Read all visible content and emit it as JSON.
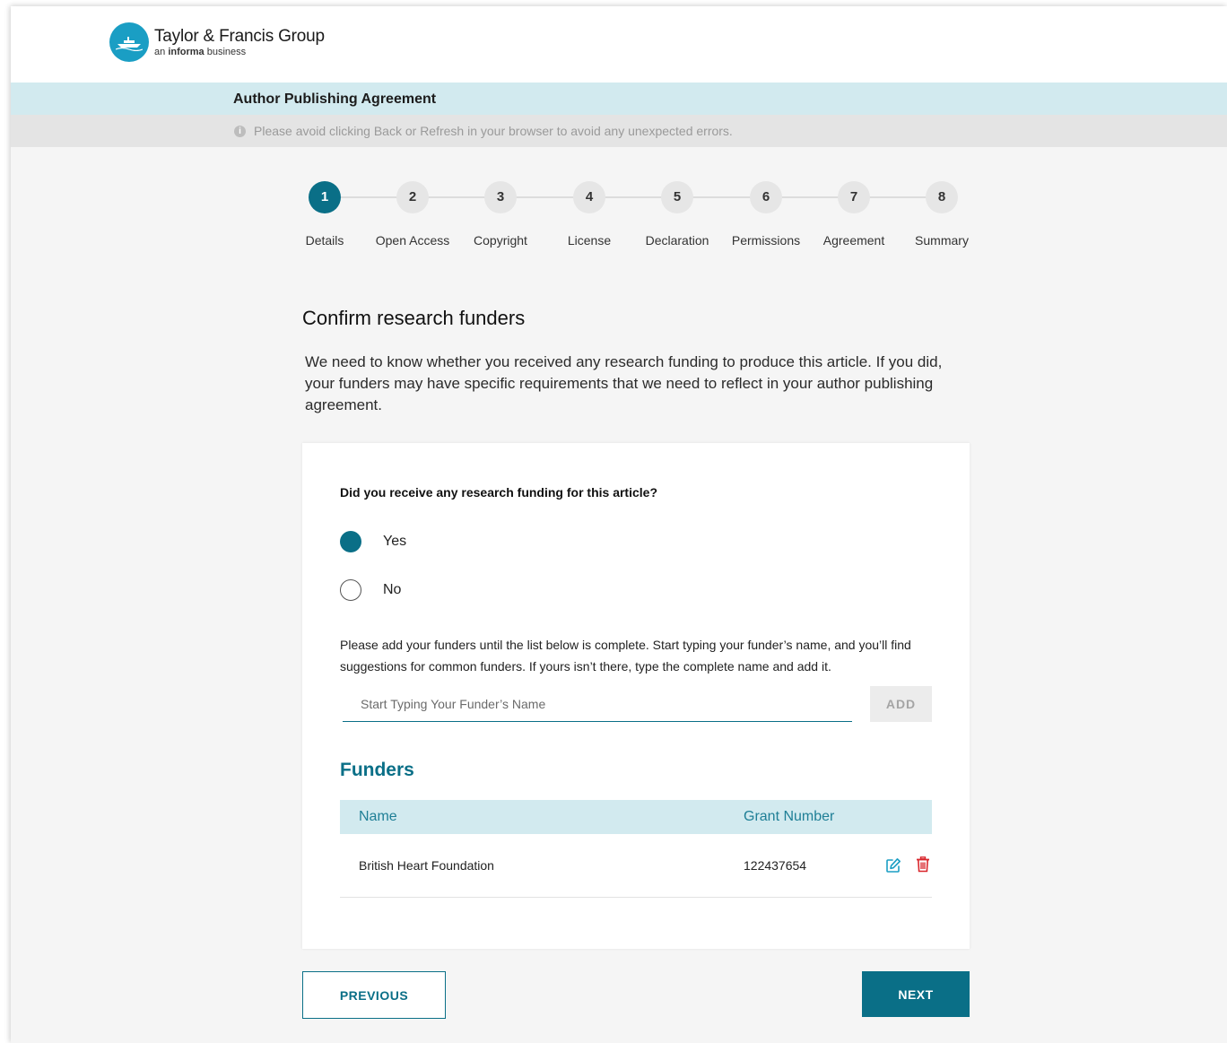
{
  "brand": {
    "name": "Taylor & Francis Group",
    "sub_prefix": "an",
    "sub_bold": "informa",
    "sub_suffix": "business",
    "color": "#1a9ec4"
  },
  "page_title": "Author Publishing Agreement",
  "notice": "Please avoid clicking Back or Refresh in your browser to avoid any unexpected errors.",
  "steps": [
    {
      "number": "1",
      "label": "Details",
      "active": true
    },
    {
      "number": "2",
      "label": "Open Access",
      "active": false
    },
    {
      "number": "3",
      "label": "Copyright",
      "active": false
    },
    {
      "number": "4",
      "label": "License",
      "active": false
    },
    {
      "number": "5",
      "label": "Declaration",
      "active": false
    },
    {
      "number": "6",
      "label": "Permissions",
      "active": false
    },
    {
      "number": "7",
      "label": "Agreement",
      "active": false
    },
    {
      "number": "8",
      "label": "Summary",
      "active": false
    }
  ],
  "section": {
    "heading": "Confirm research funders",
    "intro": "We need to know whether you received any research funding to produce this article. If you did, your funders may have specific requirements that we need to reflect in your author publishing agreement."
  },
  "form": {
    "question": "Did you receive any research funding for this article?",
    "options": [
      {
        "label": "Yes",
        "selected": true
      },
      {
        "label": "No",
        "selected": false
      }
    ],
    "help": "Please add your funders until the list below is complete. Start typing your funder’s name, and you’ll find suggestions for common funders. If yours isn’t there, type the complete name and add it.",
    "input_placeholder": "Start Typing Your Funder’s Name",
    "input_value": "",
    "add_label": "ADD"
  },
  "funders": {
    "title": "Funders",
    "columns": {
      "name": "Name",
      "grant": "Grant Number"
    },
    "rows": [
      {
        "name": "British Heart Foundation",
        "grant": "122437654",
        "edit_icon": "edit-icon",
        "delete_icon": "trash-icon"
      }
    ]
  },
  "nav": {
    "previous": "PREVIOUS",
    "next": "NEXT"
  },
  "colors": {
    "accent": "#0a6f87",
    "title_bar": "#d2eaef",
    "notice_bar": "#e4e4e4",
    "delete": "#d9262c"
  }
}
